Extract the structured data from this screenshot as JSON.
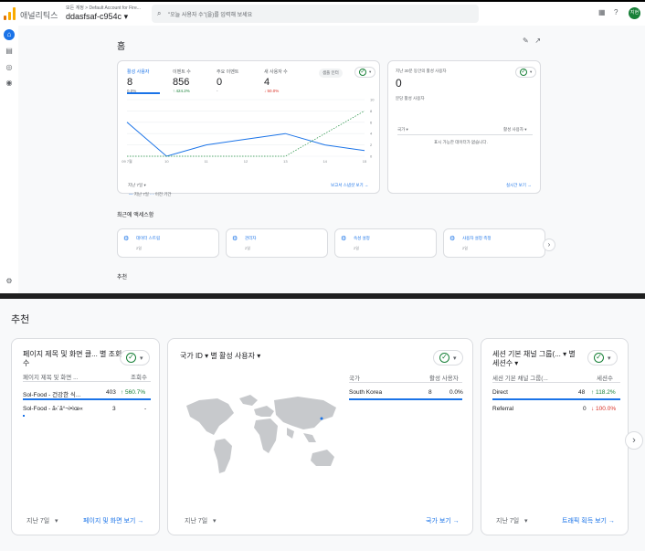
{
  "topbar": {
    "app_name": "애널리틱스",
    "account_line": "모든 계정 > Default Account for Fire...",
    "property_name": "ddasfsaf-c954c",
    "search_placeholder": "\"오늘 사용자 수\"(을)를 입력해 보세요",
    "avatar_text": "지현"
  },
  "home": {
    "title": "홈",
    "metrics": [
      {
        "label": "활성 사용자",
        "value": "8",
        "change": "0.0%"
      },
      {
        "label": "이벤트 수",
        "value": "856",
        "change": "↑ 424.2%"
      },
      {
        "label": "주요 이벤트",
        "value": "0",
        "change": "-"
      },
      {
        "label": "새 사용자 수",
        "value": "4",
        "change": "↓ 50.0%"
      }
    ],
    "sample_pill": "샘플 인터",
    "chart_legend_current": "지난 7일",
    "chart_legend_previous": "이전 기간",
    "date_range": "지난 7일",
    "report_link": "보고서 스냅샷 보기 →",
    "realtime_title": "지난 30분 동안의 활성 사용자",
    "realtime_value": "0",
    "realtime_sub": "분당 활성 사용자",
    "realtime_col1": "국가",
    "realtime_col2": "활성 사용자",
    "realtime_empty": "표시 가능한 데이터가 없습니다.",
    "realtime_link": "실시간 보기 →"
  },
  "chart_data": {
    "type": "line",
    "x": [
      "09 7월",
      "10",
      "11",
      "12",
      "13",
      "14",
      "15"
    ],
    "series": [
      {
        "name": "지난 7일",
        "values": [
          6,
          0,
          2,
          3,
          4,
          2,
          1
        ]
      },
      {
        "name": "이전 기간",
        "values": [
          0,
          0,
          0,
          0,
          0,
          4,
          8
        ]
      }
    ],
    "ylim": [
      0,
      10
    ],
    "yticks": [
      0,
      2,
      4,
      6,
      8,
      10
    ]
  },
  "recent": {
    "title": "최근에 액세스함",
    "items": [
      {
        "label": "데이터 스트림",
        "sub": "2일"
      },
      {
        "label": "관리자",
        "sub": "2일"
      },
      {
        "label": "속성 설정",
        "sub": "2일"
      },
      {
        "label": "사용자 설정 측정",
        "sub": "2일"
      }
    ],
    "next_section": "추천"
  },
  "recommend": {
    "title": "추천",
    "cards": [
      {
        "title": "페이지 제목 및 화면 클... 별 조회수",
        "col1": "페이지 제목 및 화면 ...",
        "col2": "조회수",
        "rows": [
          {
            "name": "Sol-Food - 건강한 식...",
            "value": "403",
            "change": "↑ 560.7%",
            "dir": "up"
          },
          {
            "name": "Sol-Food - ã‹´ã°¬ì•ìœ«",
            "value": "3",
            "change": "-",
            "dir": ""
          }
        ],
        "date": "지난 7일",
        "link": "페이지 및 화면 보기 →"
      },
      {
        "title": "국가 ID ▾ 별 활성 사용자 ▾",
        "col1": "국가",
        "col2": "활성 사용자",
        "rows": [
          {
            "name": "South Korea",
            "value": "8",
            "change": "0.0%",
            "dir": ""
          }
        ],
        "date": "지난 7일",
        "link": "국가 보기 →"
      },
      {
        "title": "세션 기본 채널 그룹(... ▾ 별 세션수 ▾",
        "col1": "세션 기본 채널 그룹(...",
        "col2": "세션수",
        "rows": [
          {
            "name": "Direct",
            "value": "48",
            "change": "↑ 118.2%",
            "dir": "up"
          },
          {
            "name": "Referral",
            "value": "0",
            "change": "↓ 100.0%",
            "dir": "down"
          }
        ],
        "date": "지난 7일",
        "link": "트래픽 획득 보기 →"
      }
    ]
  },
  "colors": {
    "accent": "#1a73e8",
    "up": "#188038",
    "down": "#d93025",
    "brand_orange": "#f9ab00"
  }
}
